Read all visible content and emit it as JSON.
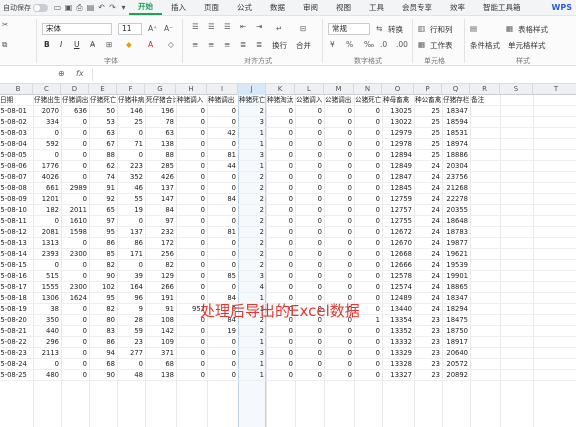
{
  "titlebar": {
    "autosave_label": "自动保存",
    "tabs": [
      "开始",
      "插入",
      "页面",
      "公式",
      "数据",
      "审阅",
      "视图",
      "工具",
      "会员专享",
      "效率",
      "智能工具箱"
    ],
    "active_tab": "开始",
    "app_label": "WPS"
  },
  "ribbon": {
    "font_name": "宋体",
    "font_size": "11",
    "number_format": "常规",
    "group_font": "字体",
    "group_align": "对齐方式",
    "group_number": "数字格式",
    "group_cells": "单元格",
    "group_styles": "样式",
    "wrap_label": "换行",
    "merge_label": "合并",
    "convert_label": "转换",
    "row_col_label": "行和列",
    "worksheet_label": "工作表",
    "cond_format_label": "条件格式",
    "table_style_label": "表格样式",
    "cell_style_label": "单元格样式"
  },
  "formula_bar": {
    "fx_label": "fx"
  },
  "columns": [
    "B",
    "C",
    "D",
    "E",
    "F",
    "G",
    "H",
    "I",
    "J",
    "K",
    "L",
    "M",
    "N",
    "O",
    "P",
    "Q",
    "R",
    "S",
    "T"
  ],
  "selected_column": "J",
  "header_row": [
    "日期",
    "仔猪出生",
    "仔猪调出",
    "仔猪死亡",
    "仔猪非病",
    "死仔猪合计",
    "种猪调入",
    "种猪调出",
    "种猪死亡",
    "种猪淘汰",
    "公猪调入",
    "公猪调出",
    "公猪死亡",
    "种母畜禽",
    "种公畜禽",
    "仔猪存栏",
    "备注"
  ],
  "rows": [
    [
      "25-08-01",
      "2070",
      "636",
      "50",
      "146",
      "196",
      "0",
      "0",
      "2",
      "0",
      "0",
      "0",
      "0",
      "13025",
      "25",
      "18347"
    ],
    [
      "25-08-02",
      "334",
      "0",
      "53",
      "25",
      "78",
      "0",
      "0",
      "3",
      "0",
      "0",
      "0",
      "0",
      "13022",
      "25",
      "18594"
    ],
    [
      "25-08-03",
      "0",
      "0",
      "63",
      "0",
      "63",
      "0",
      "42",
      "1",
      "0",
      "0",
      "0",
      "0",
      "12979",
      "25",
      "18531"
    ],
    [
      "25-08-04",
      "592",
      "0",
      "67",
      "71",
      "138",
      "0",
      "0",
      "1",
      "0",
      "0",
      "0",
      "0",
      "12978",
      "25",
      "18974"
    ],
    [
      "25-08-05",
      "0",
      "0",
      "88",
      "0",
      "88",
      "0",
      "81",
      "3",
      "0",
      "0",
      "0",
      "0",
      "12894",
      "25",
      "18886"
    ],
    [
      "25-08-06",
      "1776",
      "0",
      "62",
      "223",
      "285",
      "0",
      "44",
      "1",
      "0",
      "0",
      "0",
      "0",
      "12849",
      "24",
      "20304"
    ],
    [
      "25-08-07",
      "4026",
      "0",
      "74",
      "352",
      "426",
      "0",
      "0",
      "2",
      "0",
      "0",
      "0",
      "0",
      "12847",
      "24",
      "23756"
    ],
    [
      "25-08-08",
      "661",
      "2989",
      "91",
      "46",
      "137",
      "0",
      "0",
      "2",
      "0",
      "0",
      "0",
      "0",
      "12845",
      "24",
      "21268"
    ],
    [
      "25-08-09",
      "1201",
      "0",
      "92",
      "55",
      "147",
      "0",
      "84",
      "2",
      "0",
      "0",
      "0",
      "0",
      "12759",
      "24",
      "22278"
    ],
    [
      "25-08-10",
      "182",
      "2011",
      "65",
      "19",
      "84",
      "0",
      "0",
      "2",
      "0",
      "0",
      "0",
      "0",
      "12757",
      "24",
      "20355"
    ],
    [
      "25-08-11",
      "0",
      "1610",
      "97",
      "0",
      "97",
      "0",
      "0",
      "2",
      "0",
      "0",
      "0",
      "0",
      "12755",
      "24",
      "18648"
    ],
    [
      "25-08-12",
      "2081",
      "1598",
      "95",
      "137",
      "232",
      "0",
      "81",
      "2",
      "0",
      "0",
      "0",
      "0",
      "12672",
      "24",
      "18783"
    ],
    [
      "25-08-13",
      "1313",
      "0",
      "86",
      "86",
      "172",
      "0",
      "0",
      "2",
      "0",
      "0",
      "0",
      "0",
      "12670",
      "24",
      "19877"
    ],
    [
      "25-08-14",
      "2393",
      "2300",
      "85",
      "171",
      "256",
      "0",
      "0",
      "2",
      "0",
      "0",
      "0",
      "0",
      "12668",
      "24",
      "19621"
    ],
    [
      "25-08-15",
      "0",
      "0",
      "82",
      "0",
      "82",
      "0",
      "0",
      "2",
      "0",
      "0",
      "0",
      "0",
      "12666",
      "24",
      "19539"
    ],
    [
      "25-08-16",
      "515",
      "0",
      "90",
      "39",
      "129",
      "0",
      "85",
      "3",
      "0",
      "0",
      "0",
      "0",
      "12578",
      "24",
      "19901"
    ],
    [
      "25-08-17",
      "1555",
      "2300",
      "102",
      "164",
      "266",
      "0",
      "0",
      "4",
      "0",
      "0",
      "0",
      "0",
      "12574",
      "24",
      "18865"
    ],
    [
      "25-08-18",
      "1306",
      "1624",
      "95",
      "96",
      "191",
      "0",
      "84",
      "1",
      "0",
      "0",
      "0",
      "0",
      "12489",
      "24",
      "18347"
    ],
    [
      "25-08-19",
      "38",
      "0",
      "82",
      "9",
      "91",
      "952",
      "0",
      "1",
      "0",
      "0",
      "0",
      "0",
      "13440",
      "24",
      "18294"
    ],
    [
      "25-08-20",
      "350",
      "0",
      "80",
      "28",
      "108",
      "0",
      "84",
      "2",
      "0",
      "0",
      "0",
      "1",
      "13354",
      "23",
      "18475"
    ],
    [
      "25-08-21",
      "440",
      "0",
      "83",
      "59",
      "142",
      "0",
      "19",
      "2",
      "0",
      "0",
      "0",
      "0",
      "13352",
      "23",
      "18750"
    ],
    [
      "25-08-22",
      "296",
      "0",
      "86",
      "23",
      "109",
      "0",
      "0",
      "1",
      "0",
      "0",
      "0",
      "0",
      "13332",
      "23",
      "18917"
    ],
    [
      "25-08-23",
      "2113",
      "0",
      "94",
      "277",
      "371",
      "0",
      "0",
      "3",
      "0",
      "0",
      "0",
      "0",
      "13329",
      "23",
      "20640"
    ],
    [
      "25-08-24",
      "0",
      "0",
      "68",
      "0",
      "68",
      "0",
      "0",
      "1",
      "0",
      "0",
      "0",
      "0",
      "13328",
      "23",
      "20572"
    ],
    [
      "25-08-25",
      "480",
      "0",
      "90",
      "48",
      "138",
      "0",
      "0",
      "1",
      "0",
      "0",
      "0",
      "0",
      "13327",
      "23",
      "20892"
    ]
  ],
  "watermark": "处理后导出的Excel数据"
}
